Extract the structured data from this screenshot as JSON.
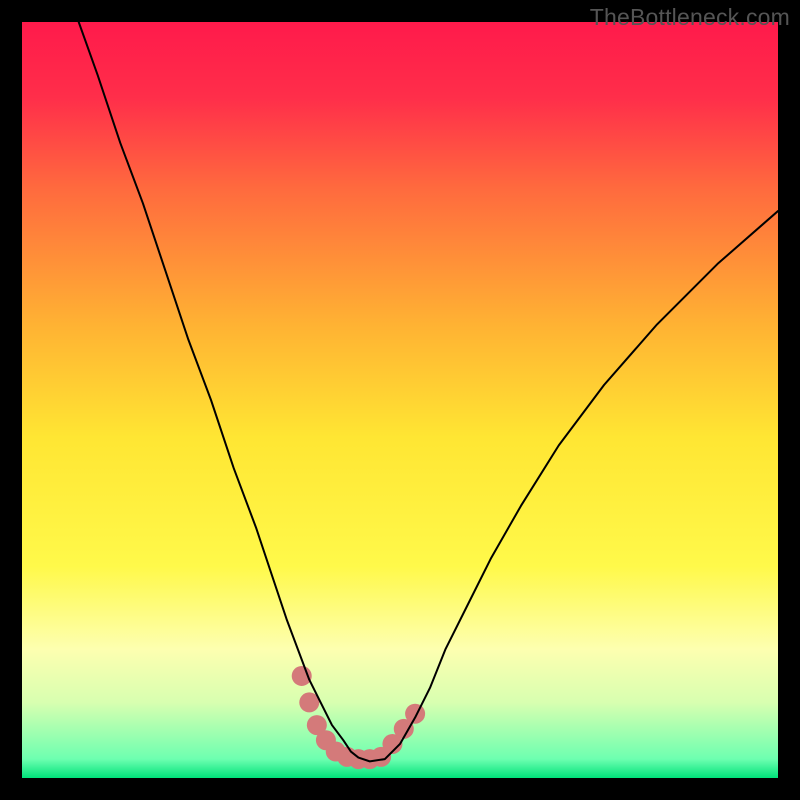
{
  "watermark": "TheBottleneck.com",
  "chart_data": {
    "type": "line",
    "title": "",
    "xlabel": "",
    "ylabel": "",
    "xlim": [
      0,
      100
    ],
    "ylim": [
      0,
      100
    ],
    "grid": false,
    "legend": false,
    "background_gradient": {
      "stops": [
        {
          "offset": 0.0,
          "color": "#ff1a4b"
        },
        {
          "offset": 0.1,
          "color": "#ff2e4a"
        },
        {
          "offset": 0.22,
          "color": "#ff6a3e"
        },
        {
          "offset": 0.4,
          "color": "#ffb233"
        },
        {
          "offset": 0.55,
          "color": "#ffe633"
        },
        {
          "offset": 0.72,
          "color": "#fff94a"
        },
        {
          "offset": 0.83,
          "color": "#fdffb0"
        },
        {
          "offset": 0.9,
          "color": "#d8ffb0"
        },
        {
          "offset": 0.975,
          "color": "#6dffb0"
        },
        {
          "offset": 1.0,
          "color": "#00e27a"
        }
      ]
    },
    "series": [
      {
        "name": "bottleneck-curve",
        "color": "#000000",
        "width": 2,
        "x": [
          7.5,
          10,
          13,
          16,
          19,
          22,
          25,
          28,
          31,
          33,
          35,
          36.5,
          38,
          39.5,
          41,
          42.5,
          43.5,
          44.5,
          46,
          48,
          50,
          52,
          54,
          56,
          59,
          62,
          66,
          71,
          77,
          84,
          92,
          100
        ],
        "values": [
          100,
          93,
          84,
          76,
          67,
          58,
          50,
          41,
          33,
          27,
          21,
          17,
          13,
          10,
          7,
          5,
          3.5,
          2.7,
          2.2,
          2.5,
          4.5,
          8,
          12,
          17,
          23,
          29,
          36,
          44,
          52,
          60,
          68,
          75
        ]
      },
      {
        "name": "highlight-band",
        "type": "scatter",
        "color": "#d47a7a",
        "marker_radius": 10,
        "x": [
          37,
          38,
          39,
          40.2,
          41.5,
          43,
          44.5,
          46,
          47.5,
          49,
          50.5,
          52
        ],
        "values": [
          13.5,
          10,
          7,
          5,
          3.5,
          2.8,
          2.5,
          2.5,
          2.8,
          4.5,
          6.5,
          8.5
        ]
      }
    ]
  }
}
